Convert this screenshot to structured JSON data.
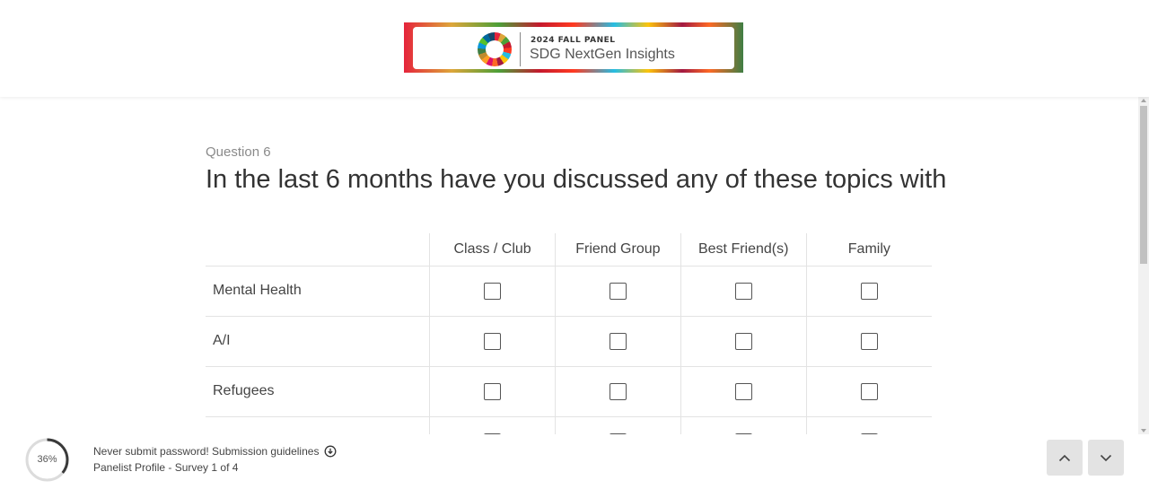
{
  "header": {
    "logo_small": "2024 FALL PANEL",
    "logo_big": "SDG NextGen Insights"
  },
  "question": {
    "number": "Question 6",
    "text": "In the last 6 months have you discussed any of these topics with"
  },
  "matrix": {
    "columns": [
      "Class / Club",
      "Friend Group",
      "Best Friend(s)",
      "Family"
    ],
    "rows": [
      {
        "label": "Mental Health",
        "checked": [
          false,
          false,
          false,
          false
        ]
      },
      {
        "label": "A/I",
        "checked": [
          false,
          false,
          false,
          false
        ]
      },
      {
        "label": "Refugees",
        "checked": [
          false,
          false,
          false,
          false
        ]
      }
    ]
  },
  "footer": {
    "progress": "36%",
    "progress_value": 0.36,
    "line1": "Never submit password! Submission guidelines",
    "line2": "Panelist Profile - Survey 1 of 4",
    "download_icon": "download-circle-icon",
    "prev_icon": "chevron-up-icon",
    "next_icon": "chevron-down-icon"
  },
  "colors": {
    "progress_track": "#dcdcdc",
    "progress_fill": "#3a3a3a",
    "nav_button_bg": "#e3e3e3"
  }
}
